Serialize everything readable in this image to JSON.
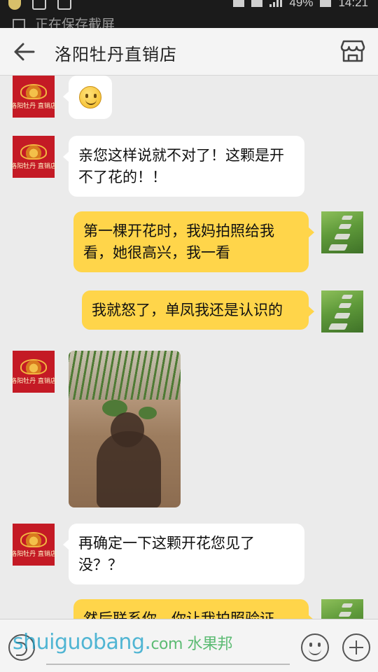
{
  "status_bar": {
    "battery": "49%",
    "time": "14:21"
  },
  "notification": {
    "text": "正在保存截屏"
  },
  "header": {
    "title": "洛阳牡丹直销店",
    "back_icon": "arrow-left-icon",
    "shop_icon": "storefront-icon"
  },
  "shop_avatar": {
    "brand": "洛阳牡丹 直销店"
  },
  "messages": [
    {
      "from": "shop",
      "kind": "emoji",
      "icon": "smiley-emoji"
    },
    {
      "from": "shop",
      "kind": "text",
      "text": "亲您这样说就不对了！这颗是开不了花的！！"
    },
    {
      "from": "me",
      "kind": "text",
      "text": "第一棵开花时，我妈拍照给我看，她很高兴，我一看"
    },
    {
      "from": "me",
      "kind": "text",
      "text": "我就怒了，单凤我还是认识的"
    },
    {
      "from": "shop",
      "kind": "image",
      "image": "garden-soil-photo"
    },
    {
      "from": "shop",
      "kind": "text",
      "text": "再确定一下这颗开花您见了没？？"
    },
    {
      "from": "me",
      "kind": "text",
      "text": "然后联系你，你让我拍照验证"
    }
  ],
  "input_bar": {
    "placeholder": "",
    "voice_icon": "voice-icon",
    "emoji_icon": "emoji-icon",
    "plus_icon": "plus-icon"
  },
  "watermark": {
    "site": "shuiguobang.",
    "tld": "com",
    "cn": "水果邦"
  },
  "colors": {
    "incoming_bubble": "#ffffff",
    "outgoing_bubble": "#ffd54a",
    "chat_bg": "#ebebeb",
    "shop_avatar_bg": "#c41a25"
  }
}
